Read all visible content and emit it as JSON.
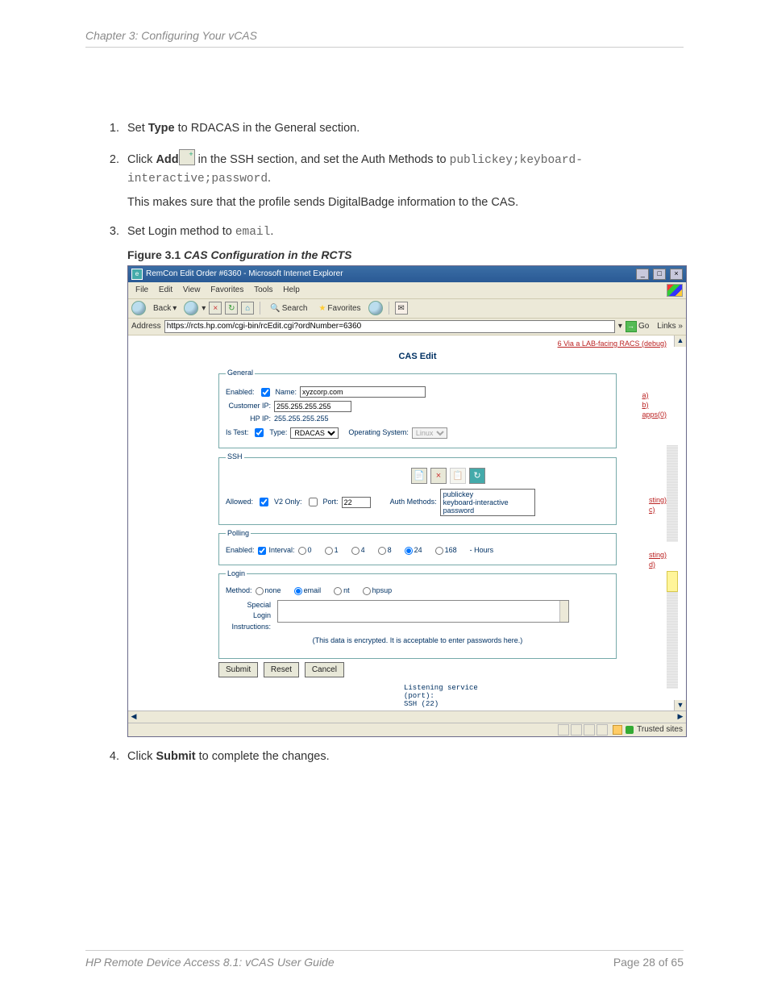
{
  "header": "Chapter 3: Configuring Your vCAS",
  "steps": {
    "s1_pre": "Set ",
    "s1_b": "Type",
    "s1_post": " to RDACAS in the General section.",
    "s2_pre": "Click ",
    "s2_b": "Add",
    "s2_post1": " in the SSH section, and set the Auth Methods to ",
    "s2_code": "publickey;keyboard-interactive;password",
    "s2_post2": ".",
    "s2_sub": "This makes sure that the profile sends DigitalBadge information to the CAS.",
    "s3_pre": "Set Login method to ",
    "s3_code": "email",
    "s3_post": ".",
    "s4_pre": "Click ",
    "s4_b": "Submit",
    "s4_post": " to complete the changes."
  },
  "figure": {
    "num": "Figure 3.1",
    "title": "CAS Configuration in the RCTS"
  },
  "ie": {
    "title": "RemCon Edit Order #6360 - Microsoft Internet Explorer",
    "menu": [
      "File",
      "Edit",
      "View",
      "Favorites",
      "Tools",
      "Help"
    ],
    "tools": {
      "back": "Back",
      "search": "Search",
      "fav": "Favorites"
    },
    "addr_label": "Address",
    "addr_url": "https://rcts.hp.com/cgi-bin/rcEdit.cgi?ordNumber=6360",
    "go": "Go",
    "links": "Links",
    "status": "Trusted sites"
  },
  "body": {
    "toplink": "6  Via a LAB-facing RACS (debug)",
    "heading": "CAS Edit",
    "general": {
      "legend": "General",
      "enabled": "Enabled:",
      "name_label": "Name:",
      "name_val": "xyzcorp.com",
      "cust_label": "Customer IP:",
      "cust_val": "255.255.255.255",
      "hpip_label": "HP IP:",
      "hpip_val": "255.255.255.255",
      "istest": "Is Test:",
      "type_label": "Type:",
      "type_val": "RDACAS",
      "os_label": "Operating System:",
      "os_val": "Linux"
    },
    "ssh": {
      "legend": "SSH",
      "allowed": "Allowed:",
      "v2": "V2 Only:",
      "port_label": "Port:",
      "port_val": "22",
      "auth_label": "Auth Methods:",
      "auth_lines": [
        "publickey",
        "keyboard-interactive",
        "password"
      ]
    },
    "polling": {
      "legend": "Polling",
      "enabled": "Enabled:",
      "interval": "Interval:",
      "opts": [
        "0",
        "1",
        "4",
        "8",
        "24",
        "168"
      ],
      "selected": "24",
      "suffix": "- Hours"
    },
    "login": {
      "legend": "Login",
      "method": "Method:",
      "opts": [
        "none",
        "email",
        "nt",
        "hpsup"
      ],
      "selected": "email",
      "sli_label": "Special\nLogin\nInstructions:"
    },
    "encnote": "(This data is encrypted. It is acceptable to enter passwords here.)",
    "buttons": {
      "submit": "Submit",
      "reset": "Reset",
      "cancel": "Cancel"
    },
    "listen": [
      "Listening service",
      "(port):",
      "SSH (22)"
    ],
    "sidelabels": {
      "a": "a)",
      "b": "b)",
      "apps": "apps(0)",
      "sting": "sting)",
      "c": "c)",
      "sting2": "sting)",
      "d": "d)"
    }
  },
  "footer": {
    "title": "HP Remote Device Access 8.1: vCAS User Guide",
    "page": "Page 28 of 65"
  }
}
